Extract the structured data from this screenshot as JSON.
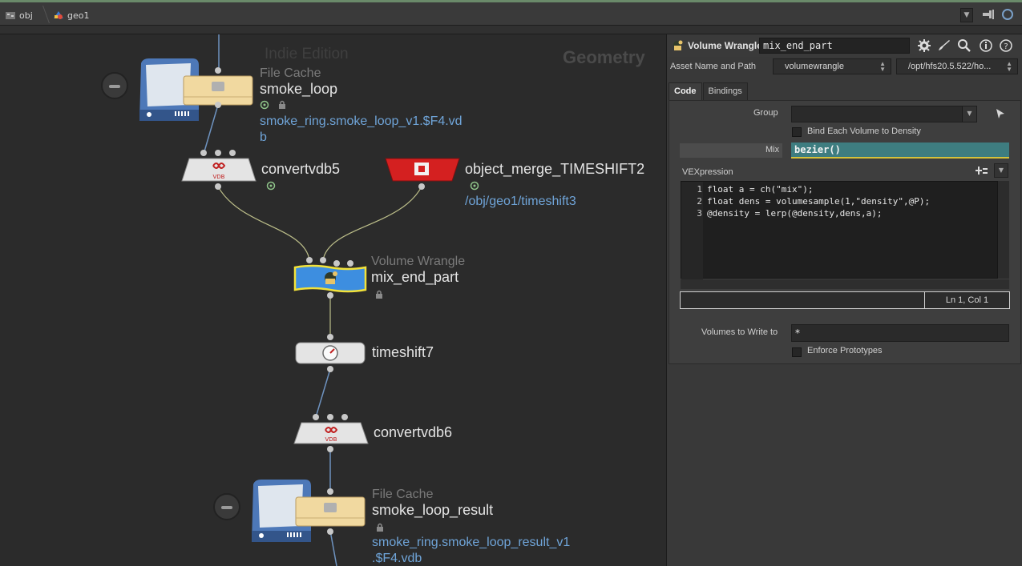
{
  "breadcrumb": {
    "root": "obj",
    "child": "geo1"
  },
  "network": {
    "watermark": "Indie Edition",
    "context": "Geometry",
    "nodes": {
      "file_cache_1": {
        "type": "File Cache",
        "name": "smoke_loop",
        "path": "smoke_ring.smoke_loop_v1.$F4.vd",
        "path2": "b"
      },
      "convertvdb5": {
        "name": "convertvdb5"
      },
      "object_merge": {
        "name": "object_merge_TIMESHIFT2",
        "path": "/obj/geo1/timeshift3"
      },
      "volume_wrangle": {
        "type": "Volume Wrangle",
        "name": "mix_end_part"
      },
      "timeshift7": {
        "name": "timeshift7"
      },
      "convertvdb6": {
        "name": "convertvdb6"
      },
      "file_cache_2": {
        "type": "File Cache",
        "name": "smoke_loop_result",
        "path": "smoke_ring.smoke_loop_result_v1",
        "path2": ".$F4.vdb"
      }
    }
  },
  "params": {
    "node_type": "Volume Wrangle",
    "node_name": "mix_end_part",
    "asset_label": "Asset Name and Path",
    "asset_name": "volumewrangle",
    "asset_path": "/opt/hfs20.5.522/ho...",
    "tabs": [
      "Code",
      "Bindings"
    ],
    "group_label": "Group",
    "group_value": "",
    "bind_label": "Bind Each Volume to Density",
    "mix_label": "Mix",
    "mix_value": "bezier()",
    "vex_label": "VEXpression",
    "code_lines": [
      {
        "num": "1",
        "text": "float a = ch(\"mix\");"
      },
      {
        "num": "2",
        "text": "float dens = volumesample(1,\"density\",@P);"
      },
      {
        "num": "3",
        "text": "@density = lerp(@density,dens,a);"
      }
    ],
    "cursor_pos": "Ln 1, Col 1",
    "volumes_label": "Volumes to Write to",
    "volumes_value": "*",
    "enforce_label": "Enforce Prototypes"
  },
  "colors": {
    "accent_green": "#6a8a6a",
    "mix_field": "#3e7d80",
    "path_text": "#6fa4d8",
    "wrangle_blue": "#3d8ee0",
    "merge_red": "#d42020",
    "cache_yellow": "#f1d9a0"
  }
}
